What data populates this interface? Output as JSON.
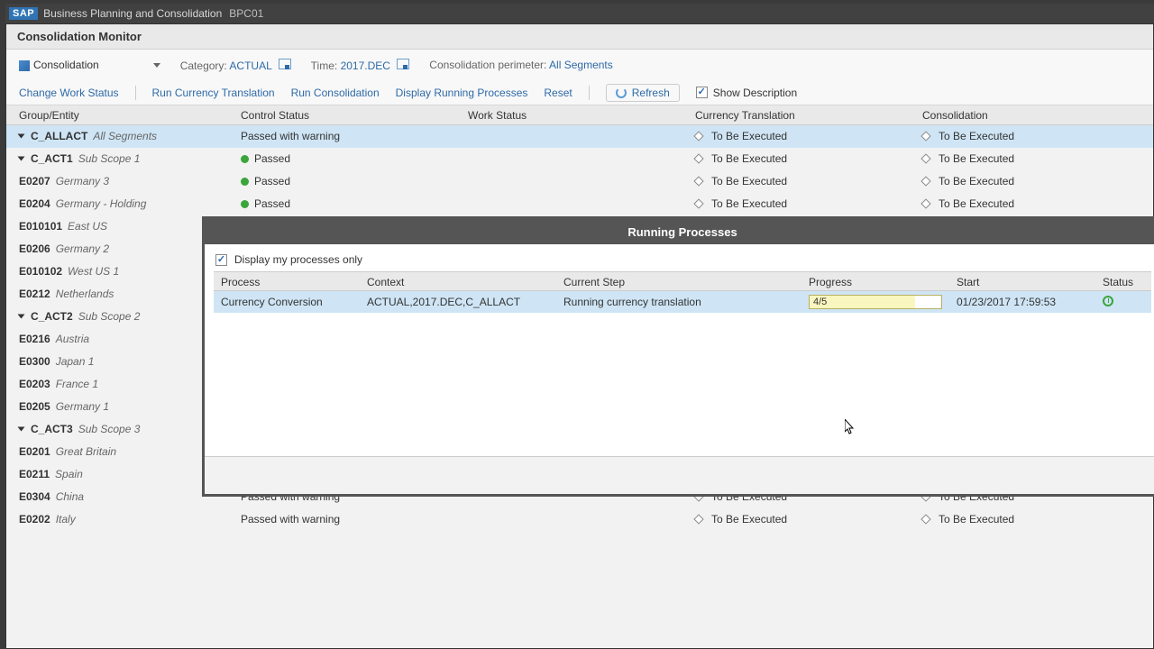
{
  "titlebar": {
    "logo": "SAP",
    "app": "Business Planning and Consolidation",
    "instance": "BPC01"
  },
  "subheader": {
    "title": "Consolidation Monitor"
  },
  "context": {
    "model": "Consolidation",
    "category_label": "Category:",
    "category_value": "ACTUAL",
    "time_label": "Time:",
    "time_value": "2017.DEC",
    "perimeter_label": "Consolidation perimeter:",
    "perimeter_value": "All Segments"
  },
  "toolbar": {
    "change_work_status": "Change Work Status",
    "run_curr": "Run Currency Translation",
    "run_cons": "Run Consolidation",
    "display_running": "Display Running Processes",
    "reset": "Reset",
    "refresh": "Refresh",
    "show_desc": "Show Description"
  },
  "grid": {
    "headers": {
      "entity": "Group/Entity",
      "control": "Control Status",
      "work": "Work Status",
      "curr": "Currency Translation",
      "cons": "Consolidation"
    },
    "tbe": "To Be Executed",
    "passed": "Passed",
    "passed_warn": "Passed with warning",
    "rows": [
      {
        "indent": 0,
        "tri": true,
        "code": "C_ALLACT",
        "desc": "All Segments",
        "ctrl": "warn",
        "sel": true
      },
      {
        "indent": 1,
        "tri": true,
        "code": "C_ACT1",
        "desc": "Sub Scope 1",
        "ctrl": "pass"
      },
      {
        "indent": 2,
        "code": "E0207",
        "desc": "Germany 3",
        "ctrl": "pass"
      },
      {
        "indent": 2,
        "code": "E0204",
        "desc": "Germany - Holding",
        "ctrl": "pass"
      },
      {
        "indent": 2,
        "code": "E010101",
        "desc": "East US"
      },
      {
        "indent": 2,
        "code": "E0206",
        "desc": "Germany 2"
      },
      {
        "indent": 2,
        "code": "E010102",
        "desc": "West US 1"
      },
      {
        "indent": 2,
        "code": "E0212",
        "desc": "Netherlands"
      },
      {
        "indent": 1,
        "tri": true,
        "code": "C_ACT2",
        "desc": "Sub Scope 2"
      },
      {
        "indent": 2,
        "code": "E0216",
        "desc": "Austria"
      },
      {
        "indent": 2,
        "code": "E0300",
        "desc": "Japan 1"
      },
      {
        "indent": 2,
        "code": "E0203",
        "desc": "France 1"
      },
      {
        "indent": 2,
        "code": "E0205",
        "desc": "Germany 1"
      },
      {
        "indent": 1,
        "tri": true,
        "code": "C_ACT3",
        "desc": "Sub Scope 3"
      },
      {
        "indent": 2,
        "code": "E0201",
        "desc": "Great Britain"
      },
      {
        "indent": 2,
        "code": "E0211",
        "desc": "Spain",
        "ctrl": "pass"
      },
      {
        "indent": 2,
        "code": "E0304",
        "desc": "China",
        "ctrl": "warn"
      },
      {
        "indent": 2,
        "code": "E0202",
        "desc": "Italy",
        "ctrl": "warn"
      }
    ]
  },
  "modal": {
    "title": "Running Processes",
    "check_label": "Display my processes only",
    "headers": {
      "process": "Process",
      "context": "Context",
      "step": "Current Step",
      "progress": "Progress",
      "start": "Start",
      "status": "Status"
    },
    "row": {
      "process": "Currency Conversion",
      "context": "ACTUAL,2017.DEC,C_ALLACT",
      "step": "Running currency translation",
      "progress_text": "4/5",
      "start": "01/23/2017 17:59:53"
    }
  }
}
